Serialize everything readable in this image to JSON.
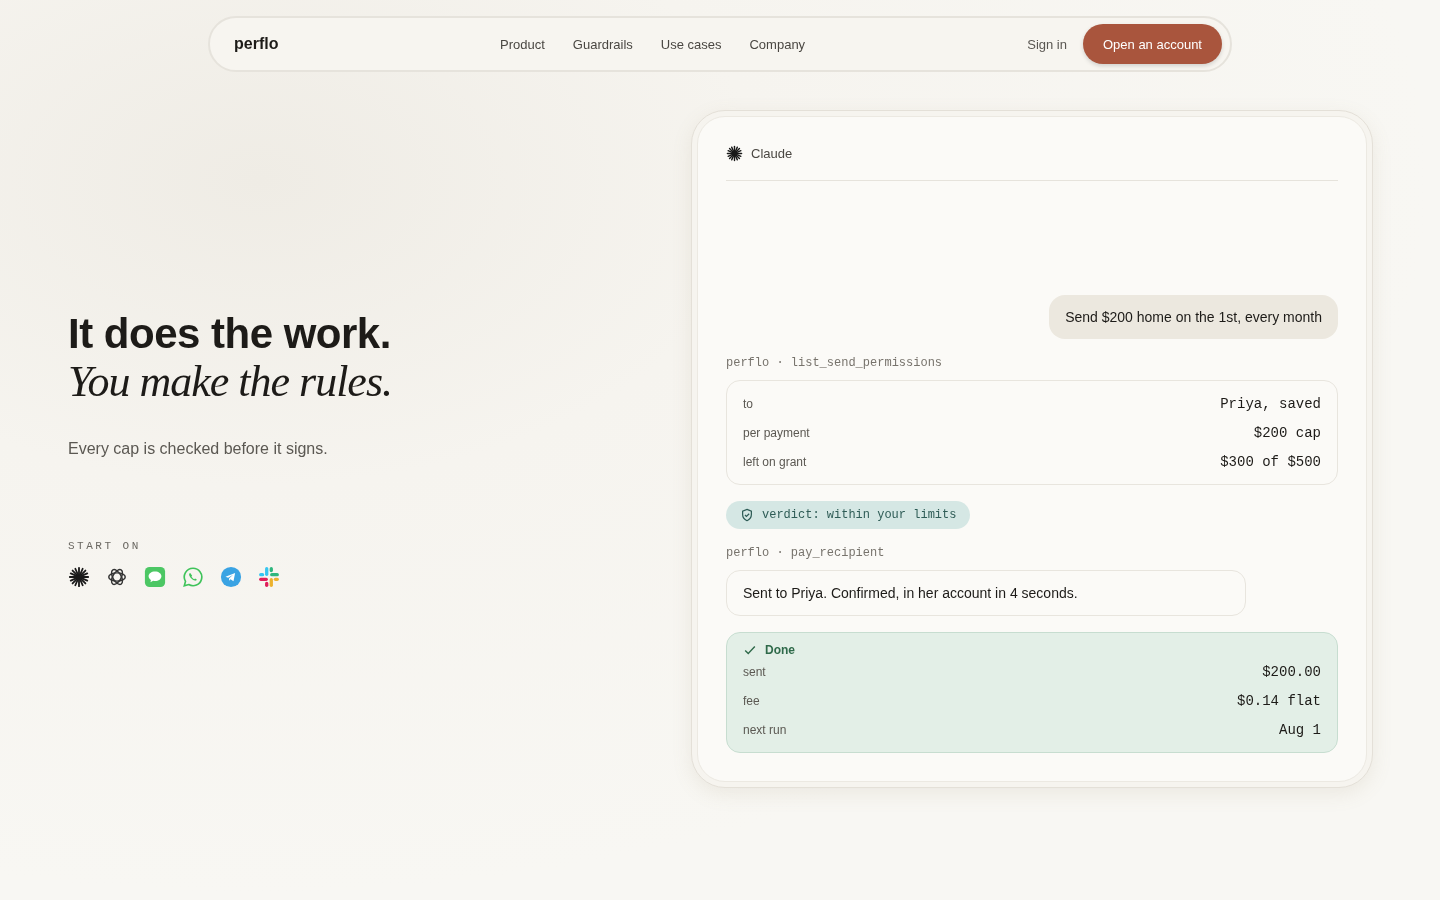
{
  "nav": {
    "logo": "perflo",
    "links": [
      "Product",
      "Guardrails",
      "Use cases",
      "Company"
    ],
    "sign_in": "Sign in",
    "cta": "Open an account"
  },
  "hero": {
    "headline": "It does the work.",
    "headline_italic": "You make the rules.",
    "subtitle": "Every cap is checked before it signs.",
    "start_label": "START ON",
    "apps": [
      {
        "kind": "claude"
      },
      {
        "kind": "openai"
      },
      {
        "kind": "messages"
      },
      {
        "kind": "whatsapp"
      },
      {
        "kind": "telegram"
      },
      {
        "kind": "slack"
      }
    ]
  },
  "chat": {
    "assistant": "Claude",
    "user_message": "Send $200 home on the 1st, every month",
    "tool_1": {
      "label": "perflo · list_send_permissions",
      "rows": [
        {
          "label": "to",
          "value": "Priya, saved"
        },
        {
          "label": "per payment",
          "value": "$200 cap"
        },
        {
          "label": "left on grant",
          "value": "$300 of $500"
        }
      ]
    },
    "verdict": "verdict: within your limits",
    "tool_2": {
      "label": "perflo · pay_recipient"
    },
    "reply": "Sent to Priya. Confirmed, in her account in 4 seconds.",
    "result": {
      "title": "Done",
      "rows": [
        {
          "label": "sent",
          "value": "$200.00"
        },
        {
          "label": "fee",
          "value": "$0.14 flat"
        },
        {
          "label": "next run",
          "value": "Aug 1"
        }
      ]
    }
  }
}
